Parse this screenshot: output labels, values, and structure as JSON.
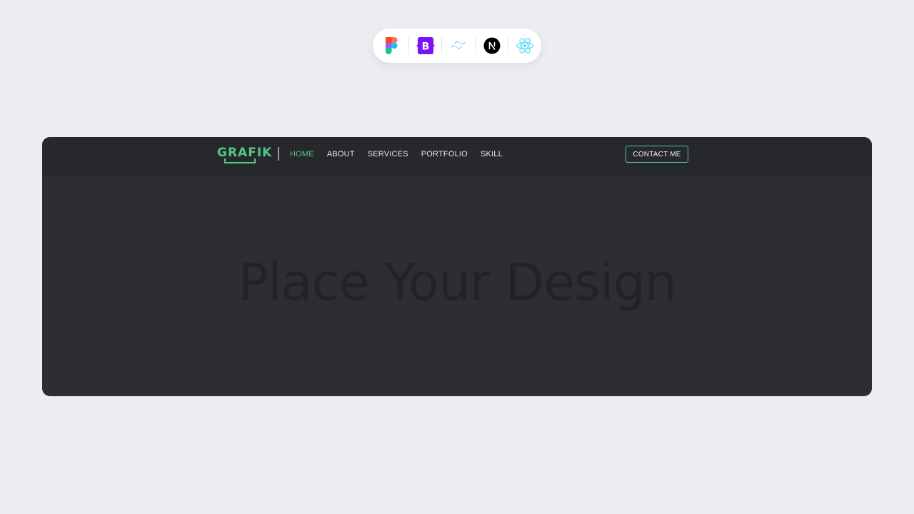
{
  "tech_stack": [
    {
      "name": "Figma",
      "icon": "figma-icon"
    },
    {
      "name": "Bootstrap",
      "icon": "bootstrap-icon",
      "color": "#7a13f5"
    },
    {
      "name": "Tailwind CSS",
      "icon": "tailwind-icon",
      "color": "#38bdf8"
    },
    {
      "name": "Next.js",
      "icon": "nextjs-icon",
      "color": "#000000"
    },
    {
      "name": "React",
      "icon": "react-icon",
      "color": "#61dafb"
    }
  ],
  "mockup": {
    "logo": "GRAFIK",
    "nav": [
      {
        "label": "HOME",
        "active": true
      },
      {
        "label": "ABOUT",
        "active": false
      },
      {
        "label": "SERVICES",
        "active": false
      },
      {
        "label": "PORTFOLIO",
        "active": false
      },
      {
        "label": "SKILL",
        "active": false
      }
    ],
    "contact_label": "CONTACT ME",
    "hero_text": "Place Your Design"
  },
  "colors": {
    "accent": "#52c78a",
    "page_background": "#eceef3",
    "mockup_background": "#2d2e33",
    "navbar_background": "#27282c"
  }
}
